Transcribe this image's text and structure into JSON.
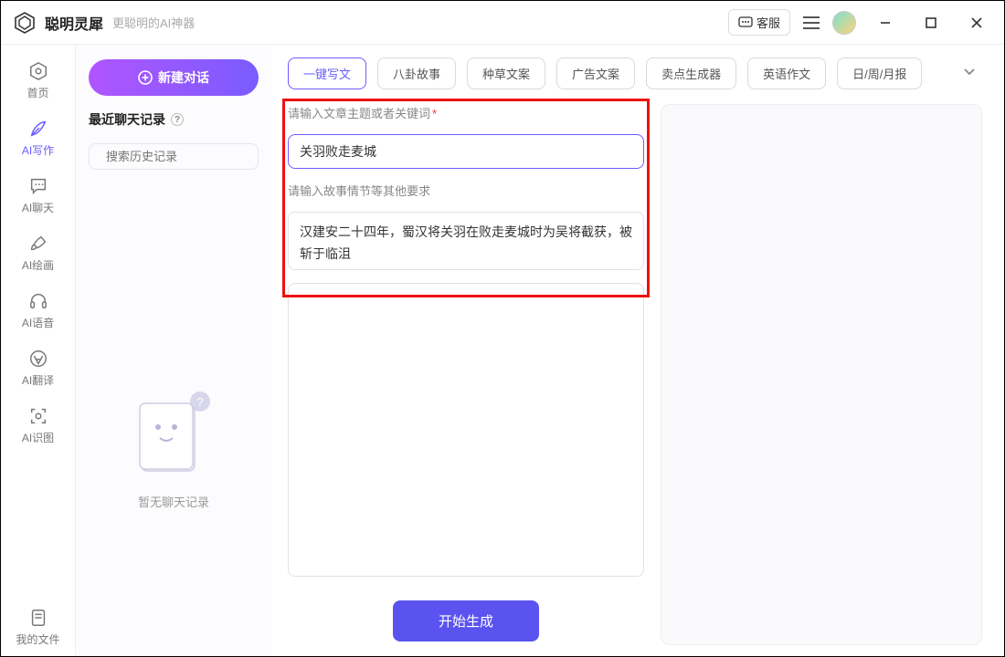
{
  "titlebar": {
    "app_name": "聪明灵犀",
    "app_sub": "更聪明的AI神器",
    "kefu_label": "客服"
  },
  "nav": {
    "items": [
      {
        "label": "首页"
      },
      {
        "label": "AI写作"
      },
      {
        "label": "AI聊天"
      },
      {
        "label": "AI绘画"
      },
      {
        "label": "AI语音"
      },
      {
        "label": "AI翻译"
      },
      {
        "label": "AI识图"
      }
    ],
    "bottom_label": "我的文件"
  },
  "sidebar": {
    "new_chat": "新建对话",
    "recent_title": "最近聊天记录",
    "search_placeholder": "搜索历史记录",
    "empty_text": "暂无聊天记录"
  },
  "tabs": {
    "items": [
      "一键写文",
      "八卦故事",
      "种草文案",
      "广告文案",
      "卖点生成器",
      "英语作文",
      "日/周/月报"
    ],
    "selected_index": 0
  },
  "form": {
    "topic_label": "请输入文章主题或者关键词",
    "topic_value": "关羽败走麦城",
    "detail_label": "请输入故事情节等其他要求",
    "detail_value": "汉建安二十四年，蜀汉将关羽在败走麦城时为吴将截获，被斩于临沮",
    "generate": "开始生成"
  }
}
